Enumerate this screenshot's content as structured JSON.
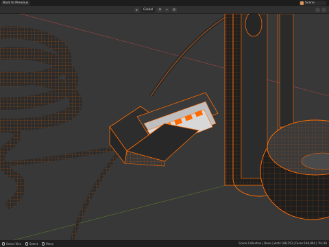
{
  "topbar": {
    "back_label": "Back to Previous",
    "scene_label": "Scene"
  },
  "header": {
    "orientation_label": "Global",
    "icons": [
      "transform-orientation-icon",
      "pivot-icon",
      "snap-icon",
      "proportional-edit-icon"
    ]
  },
  "statusbar": {
    "left_label": "Select Vise",
    "select_label": "Select",
    "move_label": "Move",
    "stats": "Scene Collection | Base | Verts:188,253 | Faces:184,894 | Tris:36"
  },
  "colors": {
    "wire": "#ff6a00",
    "mesh": "#3a3a3a",
    "background": "#383838"
  }
}
